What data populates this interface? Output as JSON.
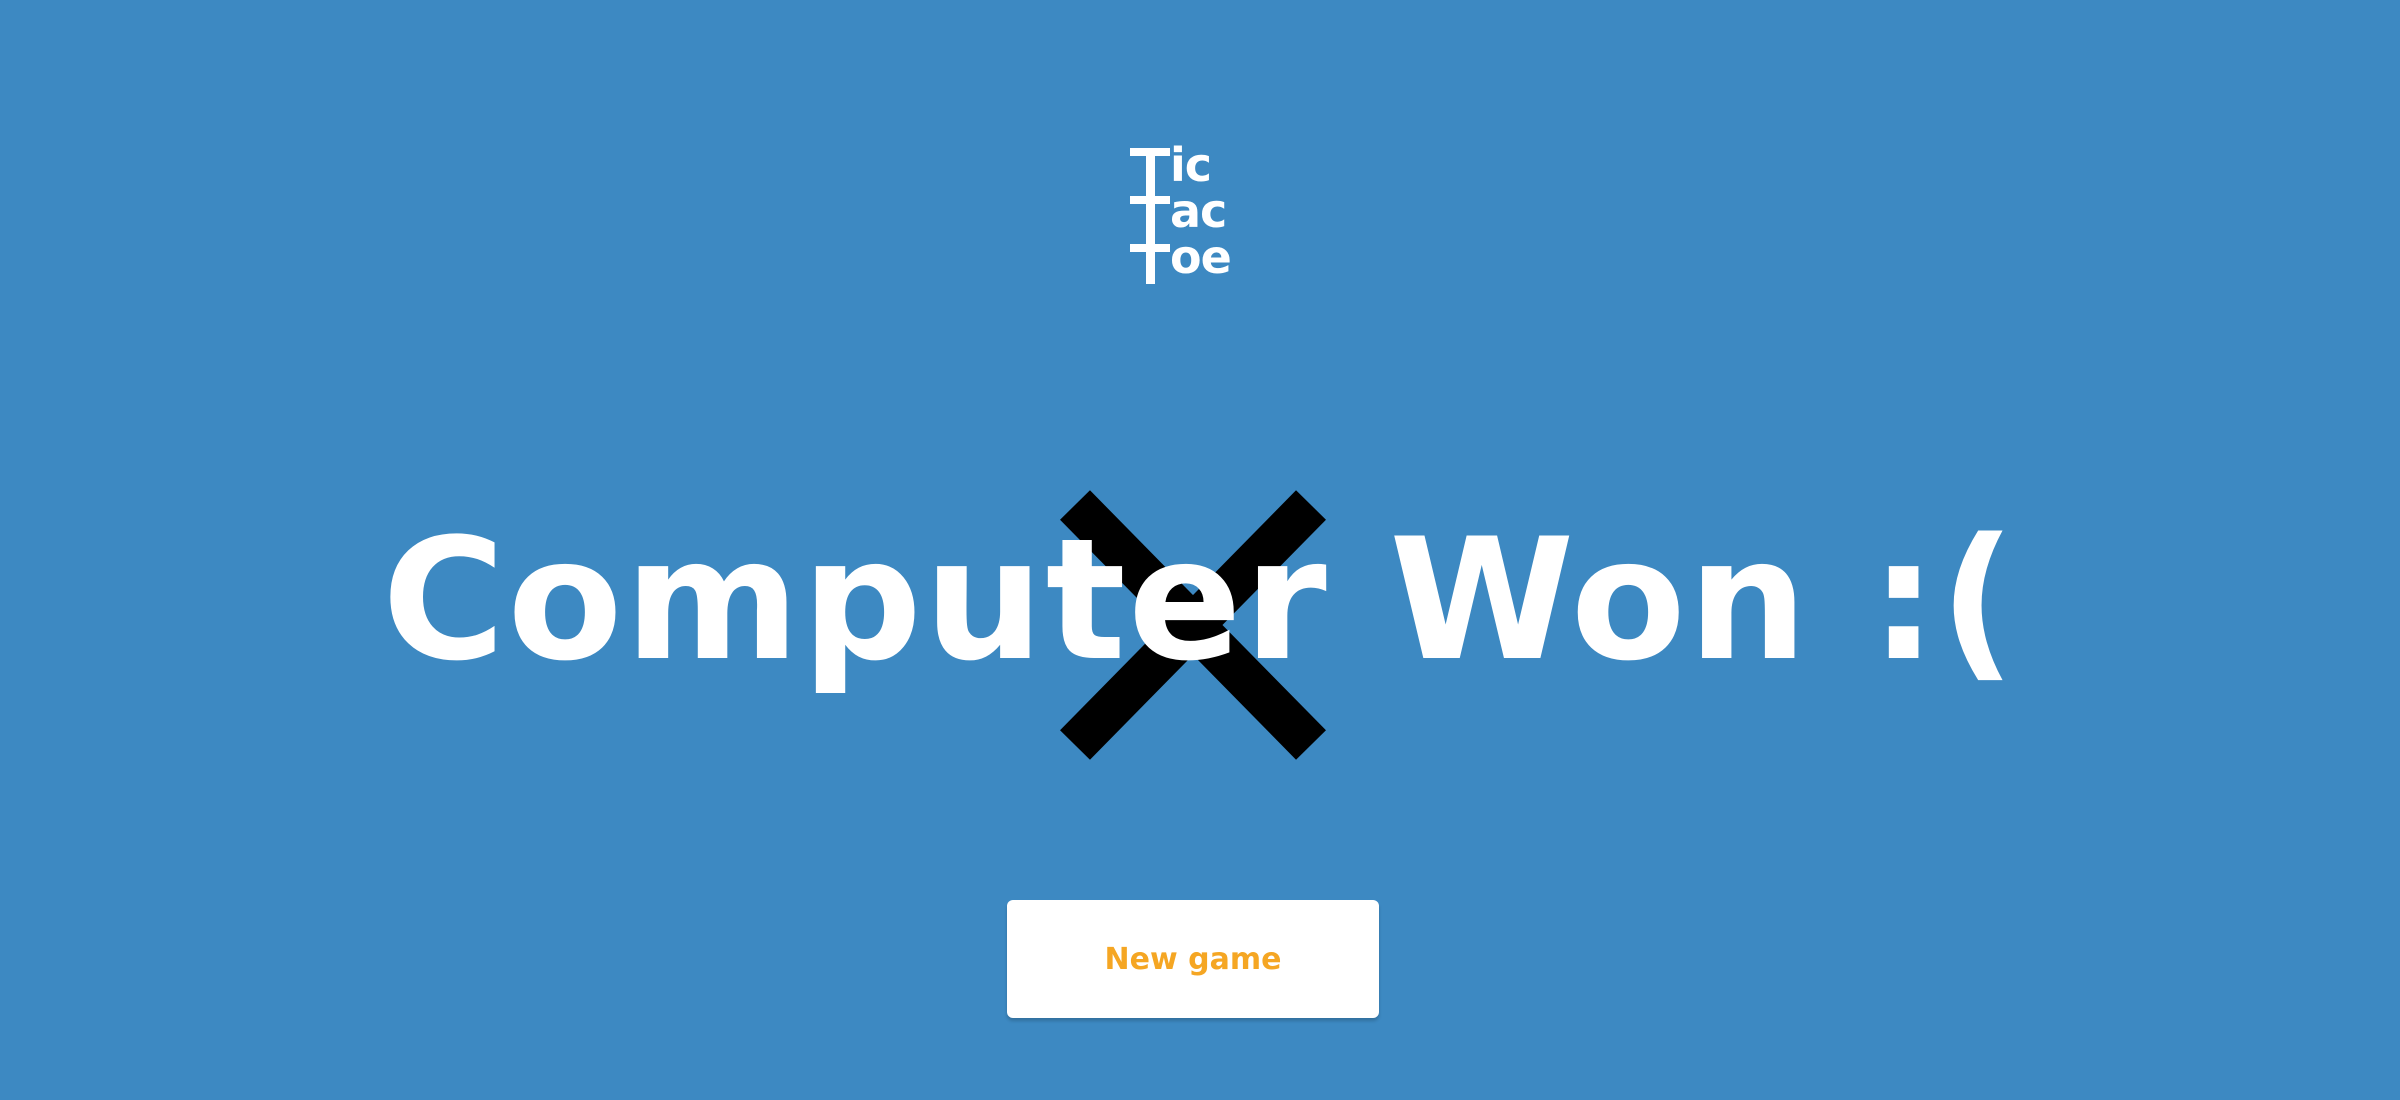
{
  "logo": {
    "line1": "ic",
    "line2": "ac",
    "line3": "oe"
  },
  "result": {
    "text": "Computer Won :("
  },
  "actions": {
    "new_game_label": "New game"
  },
  "colors": {
    "background": "#3d89c2",
    "text": "#ffffff",
    "mark": "#000000",
    "button_text": "#f5a623"
  },
  "icons": {
    "logo": "tic-tac-toe-logo",
    "mark": "x-mark-icon"
  }
}
